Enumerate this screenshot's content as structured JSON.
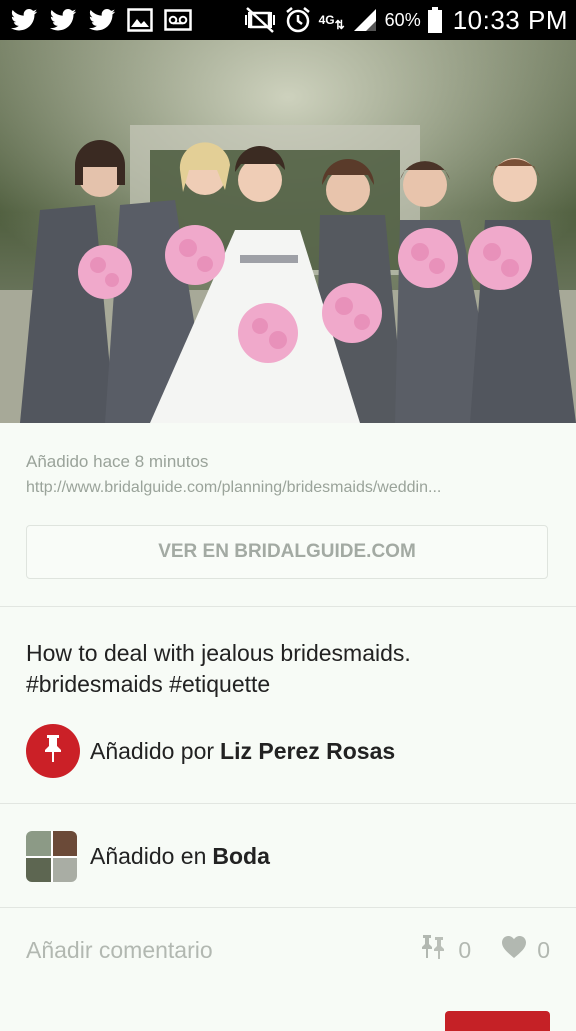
{
  "status_bar": {
    "icons": [
      "twitter-icon",
      "twitter-icon",
      "twitter-icon",
      "image-icon",
      "voicemail-icon",
      "mute-icon",
      "alarm-icon",
      "network-4g-icon",
      "signal-icon",
      "battery-icon"
    ],
    "network_label": "4G",
    "battery_percent": "60%",
    "time": "10:33 PM"
  },
  "pin": {
    "image_alt": "Bridesmaids in grey dresses with pink bouquets around the bride",
    "added_time": "Añadido hace 8 minutos",
    "source_url": "http://www.bridalguide.com/planning/bridesmaids/weddin...",
    "visit_button": "VER EN BRIDALGUIDE.COM",
    "description": "How to deal with jealous bridesmaids. #bridesmaids #etiquette",
    "added_by_prefix": "Añadido por",
    "added_by_user": "Liz Perez Rosas",
    "added_to_prefix": "Añadido en",
    "board_name": "Boda"
  },
  "comment": {
    "placeholder": "Añadir comentario"
  },
  "stats": {
    "repins": "0",
    "likes": "0"
  },
  "colors": {
    "brand_red": "#cb2027",
    "background": "#f7fbf6",
    "muted_text": "#9aa39a"
  }
}
